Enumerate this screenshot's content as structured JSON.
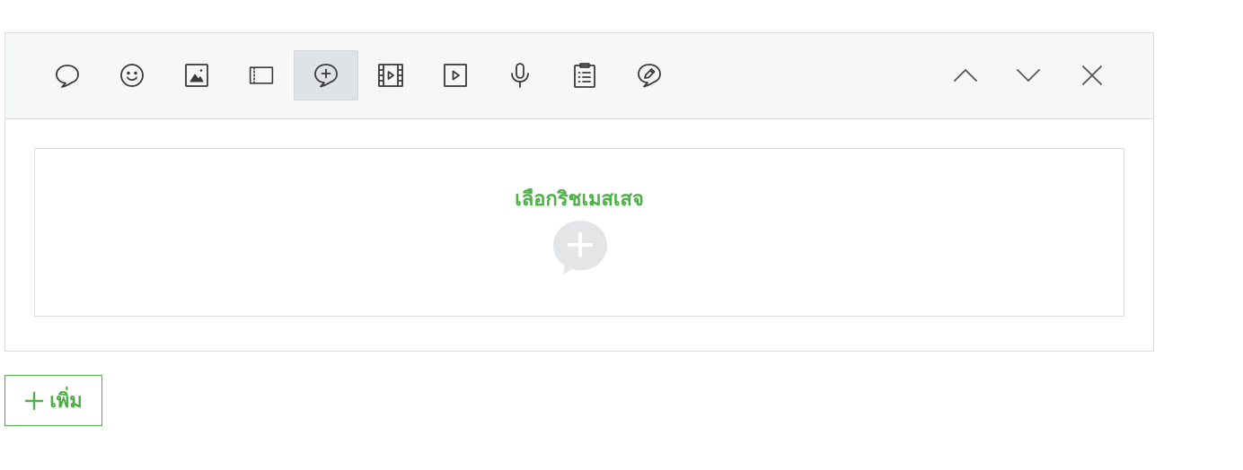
{
  "toolbar": {
    "tools": [
      {
        "icon": "speech-bubble-icon",
        "active": false
      },
      {
        "icon": "smiley-sticker-icon",
        "active": false
      },
      {
        "icon": "image-icon",
        "active": false
      },
      {
        "icon": "card-icon",
        "active": false
      },
      {
        "icon": "rich-message-icon",
        "active": true
      },
      {
        "icon": "video-film-icon",
        "active": false
      },
      {
        "icon": "rich-video-icon",
        "active": false
      },
      {
        "icon": "microphone-icon",
        "active": false
      },
      {
        "icon": "clipboard-survey-icon",
        "active": false
      },
      {
        "icon": "coupon-pen-icon",
        "active": false
      }
    ],
    "nav": [
      "chevron-up-icon",
      "chevron-down-icon",
      "close-icon"
    ]
  },
  "content": {
    "select_label": "เลือกริชเมสเสจ",
    "placeholder_icon": "add-bubble-icon"
  },
  "add_button": {
    "label": "เพิ่ม",
    "icon": "plus-icon"
  },
  "colors": {
    "accent": "#4cb046",
    "toolbar_bg": "#f6f7f7",
    "active_tool_bg": "#dfe2e6",
    "placeholder_icon": "#e3e5e7"
  }
}
